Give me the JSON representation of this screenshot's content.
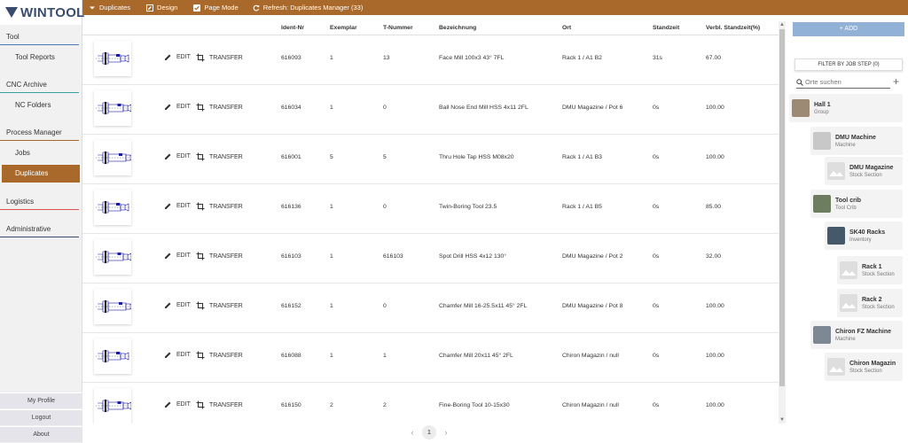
{
  "app": {
    "logo_text": "WINTOOL"
  },
  "toolbar": {
    "duplicates_label": "Duplicates",
    "design_label": "Design",
    "page_mode_label": "Page Mode",
    "refresh_label": "Refresh: Duplicates Manager (33)"
  },
  "sidebar": {
    "groups": [
      {
        "title": "Tool",
        "items": [
          "Tool Reports"
        ]
      },
      {
        "title": "CNC Archive",
        "items": [
          "NC Folders"
        ]
      },
      {
        "title": "Process Manager",
        "items": [
          "Jobs",
          "Duplicates"
        ]
      },
      {
        "title": "Logistics",
        "items": []
      },
      {
        "title": "Administrative",
        "items": []
      }
    ],
    "active_item": "Duplicates",
    "bottom": [
      "My Profile",
      "Logout",
      "About"
    ],
    "colors": {
      "tool": "#4a78b8",
      "cnc": "#3aa0a0",
      "process": "#a9692a",
      "logistics": "#d9534f",
      "administrative": "#3a4c6e"
    }
  },
  "table": {
    "headers": [
      "Ident-Nr",
      "Exemplar",
      "T-Nummer",
      "Bezeichnung",
      "Ort",
      "Standzeit",
      "Verbl. Standzeit(%)"
    ],
    "edit_label": "EDIT",
    "transfer_label": "TRANSFER",
    "rows": [
      {
        "ident": "616093",
        "exemplar": "1",
        "t_nummer": "13",
        "bezeichnung": "Face Mill 100x3 43° 7FL",
        "ort": "Rack 1 / A1 B2",
        "standzeit": "31s",
        "verbl": "67.00"
      },
      {
        "ident": "616034",
        "exemplar": "1",
        "t_nummer": "0",
        "bezeichnung": "Ball Nose End Mill HSS 4x11 2FL",
        "ort": "DMU Magazine / Pot 6",
        "standzeit": "0s",
        "verbl": "100.00"
      },
      {
        "ident": "616001",
        "exemplar": "5",
        "t_nummer": "5",
        "bezeichnung": "Thru Hole Tap HSS M08x20",
        "ort": "Rack 1 / A1 B3",
        "standzeit": "0s",
        "verbl": "100.00"
      },
      {
        "ident": "616136",
        "exemplar": "1",
        "t_nummer": "0",
        "bezeichnung": "Twin-Boring Tool 23.5",
        "ort": "Rack 1 / A1 B5",
        "standzeit": "0s",
        "verbl": "85.00"
      },
      {
        "ident": "616103",
        "exemplar": "1",
        "t_nummer": "616103",
        "bezeichnung": "Spot Drill HSS 4x12 130°",
        "ort": "DMU Magazine / Pot 2",
        "standzeit": "0s",
        "verbl": "32.00"
      },
      {
        "ident": "616152",
        "exemplar": "1",
        "t_nummer": "0",
        "bezeichnung": "Chamfer Mill 16-25.5x11 45° 2FL",
        "ort": "DMU Magazine / Pot 8",
        "standzeit": "0s",
        "verbl": "100.00"
      },
      {
        "ident": "616088",
        "exemplar": "1",
        "t_nummer": "1",
        "bezeichnung": "Chamfer Mill 20x11 45° 2FL",
        "ort": "Chiron Magazin / null",
        "standzeit": "0s",
        "verbl": "100.00"
      },
      {
        "ident": "616150",
        "exemplar": "2",
        "t_nummer": "2",
        "bezeichnung": "Fine-Boring Tool 10-15x30",
        "ort": "Chiron Magazin / null",
        "standzeit": "0s",
        "verbl": "100.00"
      }
    ]
  },
  "pagination": {
    "current": "1",
    "prev": "‹",
    "next": "›"
  },
  "right_panel": {
    "add_label": "+ ADD",
    "filter_label": "FILTER BY JOB STEP (0)",
    "search_placeholder": "Orte suchen",
    "plus": "+",
    "tree": [
      {
        "name": "Hall 1",
        "type": "Group",
        "color": "#9c8a74"
      },
      {
        "name": "DMU Machine",
        "type": "Machine",
        "color": "#c8c8c8"
      },
      {
        "name": "DMU Magazine",
        "type": "Stock Section",
        "color": "#dedede"
      },
      {
        "name": "Tool crib",
        "type": "Tool Crib",
        "color": "#6e7d60"
      },
      {
        "name": "SK40 Racks",
        "type": "Inventory",
        "color": "#45596b"
      },
      {
        "name": "Rack 1",
        "type": "Stock Section",
        "color": "#dedede"
      },
      {
        "name": "Rack 2",
        "type": "Stock Section",
        "color": "#dedede"
      },
      {
        "name": "Chiron FZ Machine",
        "type": "Machine",
        "color": "#7d8894"
      },
      {
        "name": "Chiron Magazin",
        "type": "Stock Section",
        "color": "#dedede"
      }
    ]
  }
}
